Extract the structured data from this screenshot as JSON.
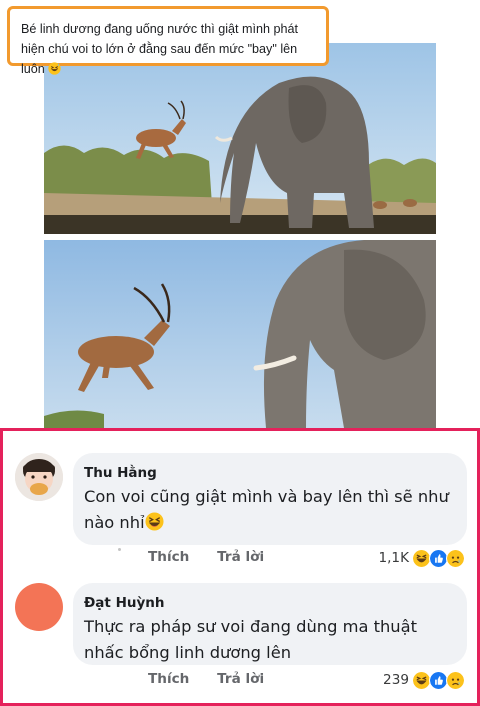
{
  "post": {
    "caption": "Bé linh dương đang uống nước thì giật mình phát hiện chú voi to lớn ở đằng sau đến mức \"bay\" lên luôn",
    "caption_emoji": "grinning-sweat-emoji"
  },
  "comments": [
    {
      "author": "Thu Hằng",
      "text": "Con voi cũng giật mình và bay lên thì sẽ như nào nhỉ",
      "text_emoji": "laughing-squint-emoji",
      "like_label": "Thích",
      "reply_label": "Trả lời",
      "reaction_count": "1,1K",
      "reactions": [
        "haha-icon",
        "like-icon",
        "sad-icon"
      ]
    },
    {
      "author": "Đạt Huỳnh",
      "text": "Thực ra pháp sư voi đang dùng ma thuật\nnhấc bổng linh dương lên",
      "like_label": "Thích",
      "reply_label": "Trả lời",
      "reaction_count": "239",
      "reactions": [
        "haha-icon",
        "like-icon",
        "sad-icon"
      ]
    }
  ],
  "colors": {
    "caption_border": "#f29a2e",
    "comments_border": "#e4215b",
    "bubble_bg": "#f0f2f5",
    "secondary_text": "#65676b",
    "avatar2": "#f37456"
  }
}
